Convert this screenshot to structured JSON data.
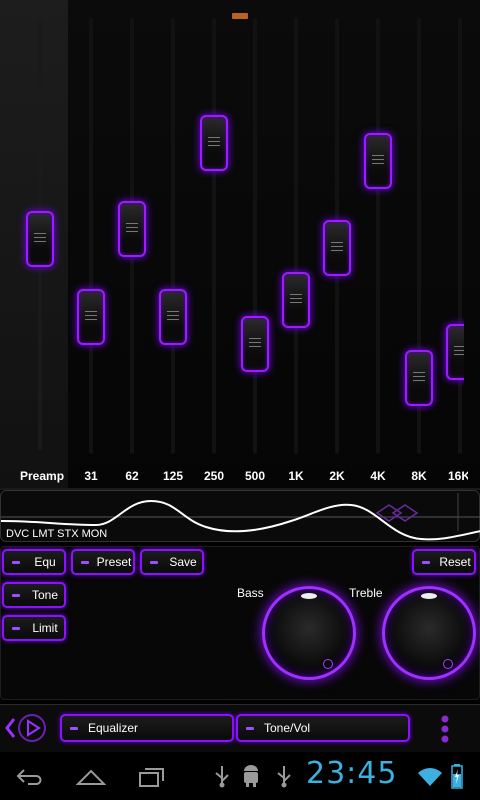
{
  "equalizer": {
    "bands": [
      {
        "label": "Preamp",
        "level": 0.0
      },
      {
        "label": "31",
        "level": -4.5
      },
      {
        "label": "62",
        "level": 0.6
      },
      {
        "label": "125",
        "level": -4.5
      },
      {
        "label": "250",
        "level": 5.5
      },
      {
        "label": "500",
        "level": -6.0
      },
      {
        "label": "1K",
        "level": -3.5
      },
      {
        "label": "2K",
        "level": -0.5
      },
      {
        "label": "4K",
        "level": 4.5
      },
      {
        "label": "8K",
        "level": -8.0
      },
      {
        "label": "16K",
        "level": -6.5
      }
    ],
    "accent_color": "#9a1cff"
  },
  "curve_panel": {
    "mode_text": "DVC LMT STX MON"
  },
  "buttons": {
    "equ": "Equ",
    "tone": "Tone",
    "limit": "Limit",
    "preset": "Preset",
    "save": "Save",
    "reset": "Reset"
  },
  "dials": {
    "bass_label": "Bass",
    "treble_label": "Treble"
  },
  "bottom_bar": {
    "equalizer_tab": "Equalizer",
    "tonevol_tab": "Tone/Vol"
  },
  "status_bar": {
    "clock": "23:45"
  },
  "icons": [
    "back-icon",
    "home-icon",
    "recent-apps-icon",
    "usb-icon",
    "android-debug-icon",
    "usb-icon",
    "wifi-icon",
    "battery-charging-icon",
    "play-icon",
    "menu-dots-icon"
  ]
}
